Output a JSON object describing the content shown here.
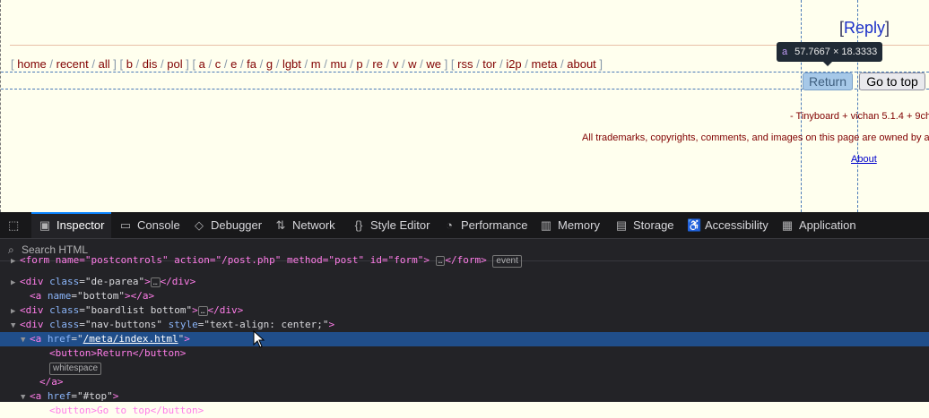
{
  "page": {
    "reply_link": "Reply",
    "boardlist": {
      "group1": [
        "home",
        "recent",
        "all"
      ],
      "group2": [
        "b",
        "dis",
        "pol"
      ],
      "group3": [
        "a",
        "c",
        "e",
        "fa",
        "g",
        "lgbt",
        "m",
        "mu",
        "p",
        "re",
        "v",
        "w",
        "we"
      ],
      "group4": [
        "rss",
        "tor",
        "i2p",
        "meta",
        "about"
      ]
    },
    "return_button": "Return",
    "top_button": "Go to top",
    "tooltip_tag": "a",
    "tooltip_size": "57.7667 × 18.3333",
    "footer_line1": "- Tinyboard + vichan 5.1.4 + 9ch",
    "footer_line2": "All trademarks, copyrights, comments, and images on this page are owned by ar",
    "about_link": "About"
  },
  "devtools": {
    "tabs": [
      "Inspector",
      "Console",
      "Debugger",
      "Network",
      "Style Editor",
      "Performance",
      "Memory",
      "Storage",
      "Accessibility",
      "Application"
    ],
    "search_placeholder": "Search HTML",
    "tree": [
      {
        "indent": 2,
        "twisty": "▶",
        "parts": [
          "<form name=\"postcontrols\" action=\"/post.php\" method=\"post\" id=\"form\">",
          "…",
          "</form>"
        ],
        "badge": "event",
        "clip": true
      },
      {
        "indent": 2,
        "twisty": "▶",
        "tag_open": "<div",
        "attr": "class",
        "val": "de-parea",
        "tag_close": ">",
        "ellipsis": true,
        "end": "</div>"
      },
      {
        "indent": 3,
        "twisty": "",
        "tag_open": "<a",
        "attr": "name",
        "val": "bottom",
        "tag_close": "></a>"
      },
      {
        "indent": 2,
        "twisty": "▶",
        "tag_open": "<div",
        "attr": "class",
        "val": "boardlist bottom",
        "tag_close": ">",
        "ellipsis": true,
        "end": "</div>"
      },
      {
        "indent": 2,
        "twisty": "▼",
        "tag_open": "<div",
        "attr": "class",
        "val": "nav-buttons",
        "attr2": "style",
        "val2": "text-align: center;",
        "tag_close": ">"
      },
      {
        "indent": 3,
        "twisty": "▼",
        "tag_open": "<a",
        "attr": "href",
        "val": "/meta/index.html",
        "tag_close": ">",
        "selected": true
      },
      {
        "indent": 5,
        "twisty": "",
        "raw": "<button>Return</button>"
      },
      {
        "indent": 5,
        "twisty": "",
        "badge_only": "whitespace"
      },
      {
        "indent": 4,
        "twisty": "",
        "raw": "</a>"
      },
      {
        "indent": 3,
        "twisty": "▼",
        "tag_open": "<a",
        "attr": "href",
        "val": "#top",
        "tag_close": ">"
      },
      {
        "indent": 5,
        "twisty": "",
        "raw": "<button>Go to top</button>"
      }
    ]
  },
  "colors": {
    "page_bg": "#ffffee",
    "link": "#800000",
    "devtools_bg": "#232327",
    "selected_row": "#204e8a"
  }
}
